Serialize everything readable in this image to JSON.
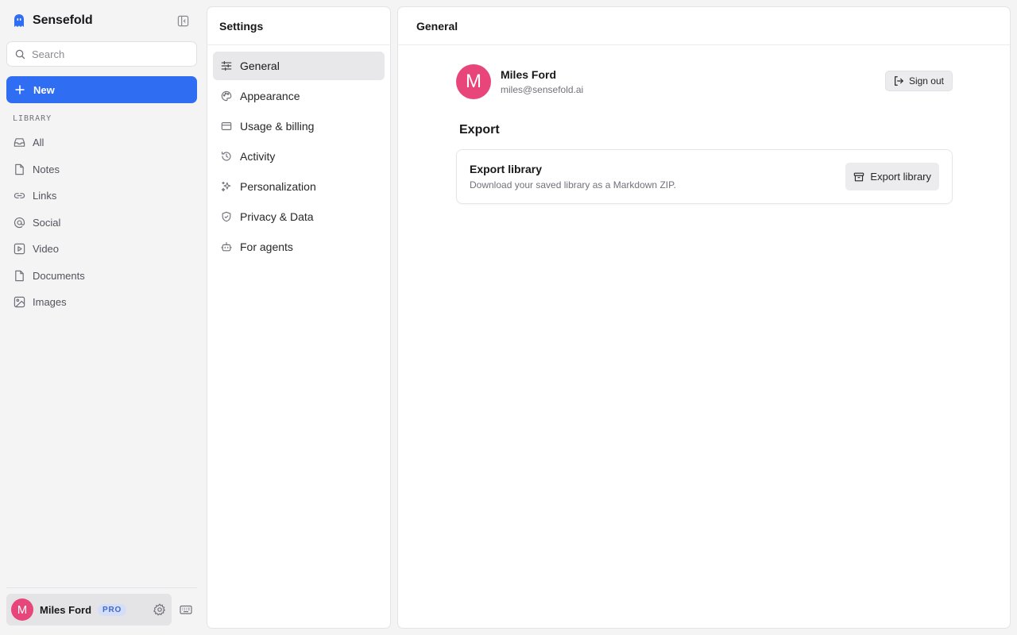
{
  "app": {
    "name": "Sensefold",
    "brand_color": "#2f6df3"
  },
  "sidebar": {
    "search_placeholder": "Search",
    "new_label": "New",
    "library_label": "LIBRARY",
    "items": [
      {
        "label": "All",
        "icon": "inbox-icon"
      },
      {
        "label": "Notes",
        "icon": "note-icon"
      },
      {
        "label": "Links",
        "icon": "link-icon"
      },
      {
        "label": "Social",
        "icon": "at-icon"
      },
      {
        "label": "Video",
        "icon": "video-icon"
      },
      {
        "label": "Documents",
        "icon": "document-icon"
      },
      {
        "label": "Images",
        "icon": "image-icon"
      }
    ],
    "user": {
      "initial": "M",
      "name": "Miles Ford",
      "badge": "PRO"
    }
  },
  "settings": {
    "title": "Settings",
    "items": [
      {
        "label": "General",
        "icon": "sliders-icon",
        "active": true
      },
      {
        "label": "Appearance",
        "icon": "palette-icon"
      },
      {
        "label": "Usage & billing",
        "icon": "credit-card-icon"
      },
      {
        "label": "Activity",
        "icon": "history-icon"
      },
      {
        "label": "Personalization",
        "icon": "sparkles-icon"
      },
      {
        "label": "Privacy & Data",
        "icon": "shield-icon"
      },
      {
        "label": "For agents",
        "icon": "bot-icon"
      }
    ]
  },
  "main": {
    "title": "General",
    "profile": {
      "initial": "M",
      "name": "Miles Ford",
      "email": "miles@sensefold.ai",
      "signout_label": "Sign out",
      "avatar_color": "#e8457a"
    },
    "export": {
      "section_title": "Export",
      "card_title": "Export library",
      "card_description": "Download your saved library as a Markdown ZIP.",
      "button_label": "Export library"
    }
  }
}
